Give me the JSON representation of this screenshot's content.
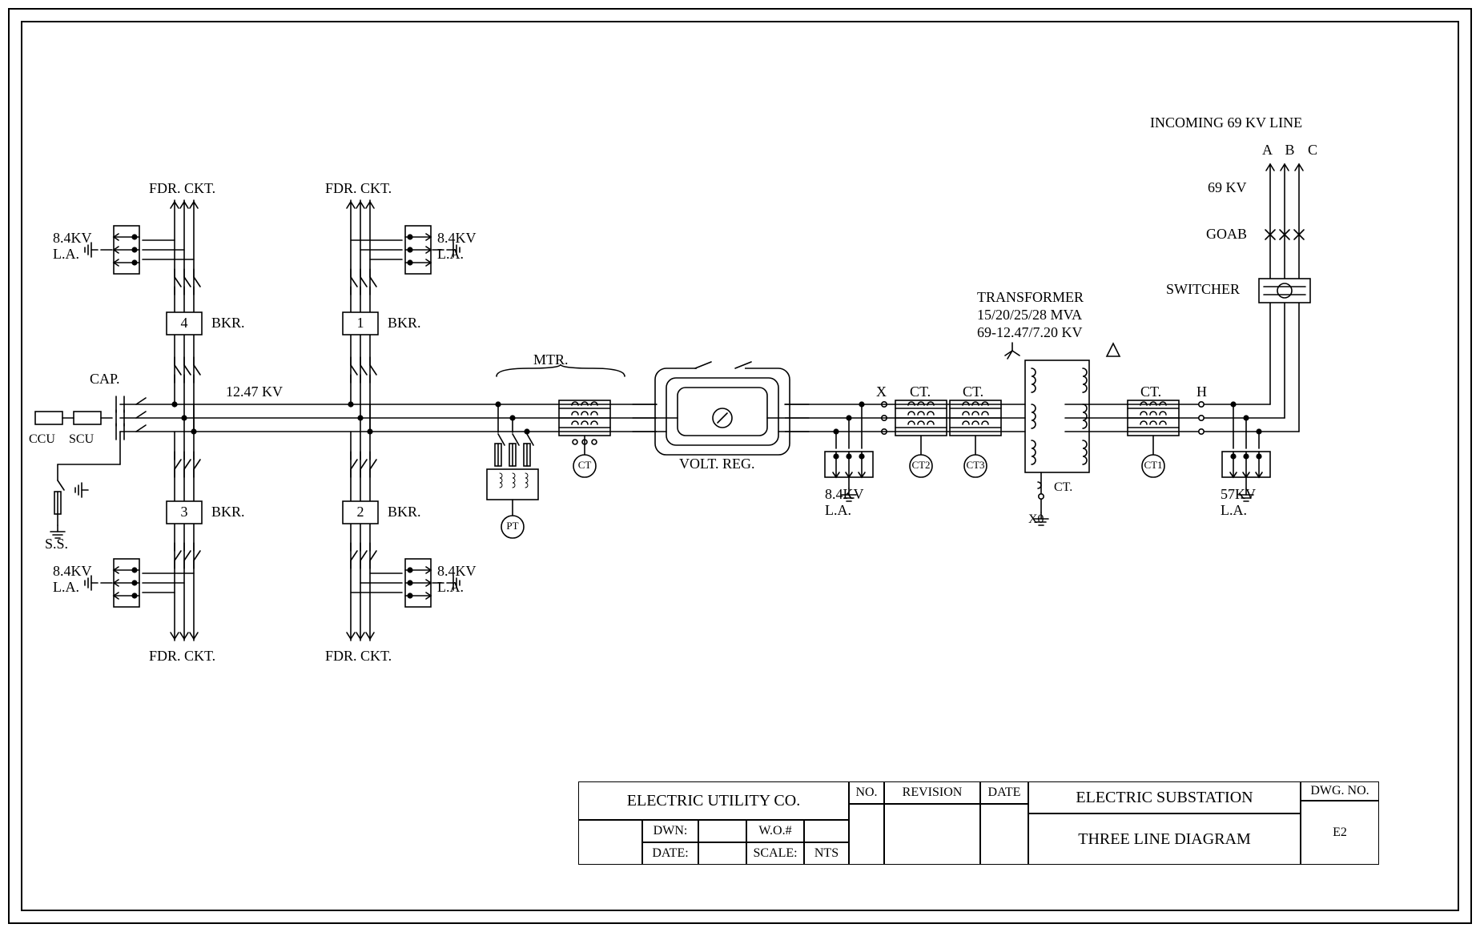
{
  "incoming": {
    "title": "INCOMING 69 KV LINE",
    "phases": "A B C",
    "kv": "69 KV",
    "goab": "GOAB",
    "switcher": "SWITCHER"
  },
  "transformer": {
    "label": "TRANSFORMER",
    "rating": "15/20/25/28 MVA",
    "voltage": "69-12.47/7.20 KV",
    "x0": "X0"
  },
  "bus": {
    "kv": "12.47 KV",
    "H": "H",
    "X": "X"
  },
  "ct": {
    "ct": "CT.",
    "ct_lbl": "CT",
    "ct1": "CT1",
    "ct2": "CT2",
    "ct3": "CT3",
    "pt": "PT"
  },
  "la": {
    "hv": "57KV\nL.A.",
    "lv": "8.4KV\nL.A."
  },
  "mtr": "MTR.",
  "voltreg": "VOLT. REG.",
  "feeders": {
    "fdr": "FDR. CKT.",
    "bkr": "BKR.",
    "n1": "1",
    "n2": "2",
    "n3": "3",
    "n4": "4"
  },
  "left": {
    "cap": "CAP.",
    "ccu": "CCU",
    "scu": "SCU",
    "ss": "S.S."
  },
  "titleblock": {
    "company": "ELECTRIC UTILITY CO.",
    "dwn": "DWN:",
    "date": "DATE:",
    "wo": "W.O.#",
    "scale": "SCALE:",
    "nts": "NTS",
    "no": "NO.",
    "rev": "REVISION",
    "dt": "DATE",
    "proj": "ELECTRIC SUBSTATION",
    "title": "THREE LINE DIAGRAM",
    "dwgno": "DWG. NO.",
    "num": "E2"
  }
}
